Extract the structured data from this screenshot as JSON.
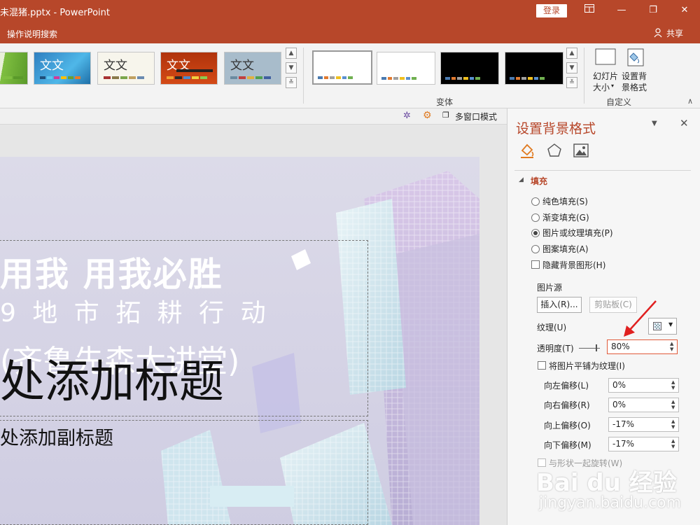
{
  "titlebar": {
    "title": "未混猪.pptx  -  PowerPoint",
    "login_label": "登录",
    "ribbon_display_icon": "ribbon-display-icon",
    "minimize_glyph": "—",
    "restore_glyph": "❐",
    "close_glyph": "✕"
  },
  "tellbar": {
    "search_label": "操作说明搜索",
    "share_label": "共享"
  },
  "ribbon": {
    "themes": [
      {
        "text": "",
        "bg": "#7fbf40"
      },
      {
        "text": "文文",
        "bg": "#3a9fd6"
      },
      {
        "text": "文文",
        "bg": "#f7f5ec"
      },
      {
        "text": "文文",
        "bg": "#c0360c"
      },
      {
        "text": "文文",
        "bg": "#a8bccb"
      }
    ],
    "variants_label": "变体",
    "slide_size_label_1": "幻灯片",
    "slide_size_label_2": "大小",
    "format_bg_label_1": "设置背",
    "format_bg_label_2": "景格式",
    "customize_label": "自定义"
  },
  "viewbar": {
    "multiwindow_label": "多窗口模式"
  },
  "slide": {
    "line1": "用我  用我必胜",
    "line2": "9 地 市 拓 耕 行 动",
    "line3": "(齐鲁先森大讲堂)",
    "title_placeholder": "处添加标题",
    "subtitle_placeholder": "处添加副标题"
  },
  "pane": {
    "title": "设置背景格式",
    "section_fill": "填充",
    "fill_options": [
      {
        "label": "纯色填充(S)",
        "selected": false
      },
      {
        "label": "渐变填充(G)",
        "selected": false
      },
      {
        "label": "图片或纹理填充(P)",
        "selected": true
      },
      {
        "label": "图案填充(A)",
        "selected": false
      }
    ],
    "hide_bg_graphics": "隐藏背景图形(H)",
    "picture_source": "图片源",
    "insert_button": "插入(R)...",
    "clipboard_button": "剪贴板(C)",
    "texture_label": "纹理(U)",
    "transparency_label": "透明度(T)",
    "transparency_value": "80%",
    "tile_label": "将图片平铺为纹理(I)",
    "offsets": [
      {
        "label": "向左偏移(L)",
        "value": "0%"
      },
      {
        "label": "向右偏移(R)",
        "value": "0%"
      },
      {
        "label": "向上偏移(O)",
        "value": "-17%"
      },
      {
        "label": "向下偏移(M)",
        "value": "-17%"
      }
    ],
    "rotate_with_shape": "与形状一起旋转(W)"
  },
  "watermark": {
    "brand": "Bai du 经验",
    "url": "jingyan.baidu.com"
  }
}
